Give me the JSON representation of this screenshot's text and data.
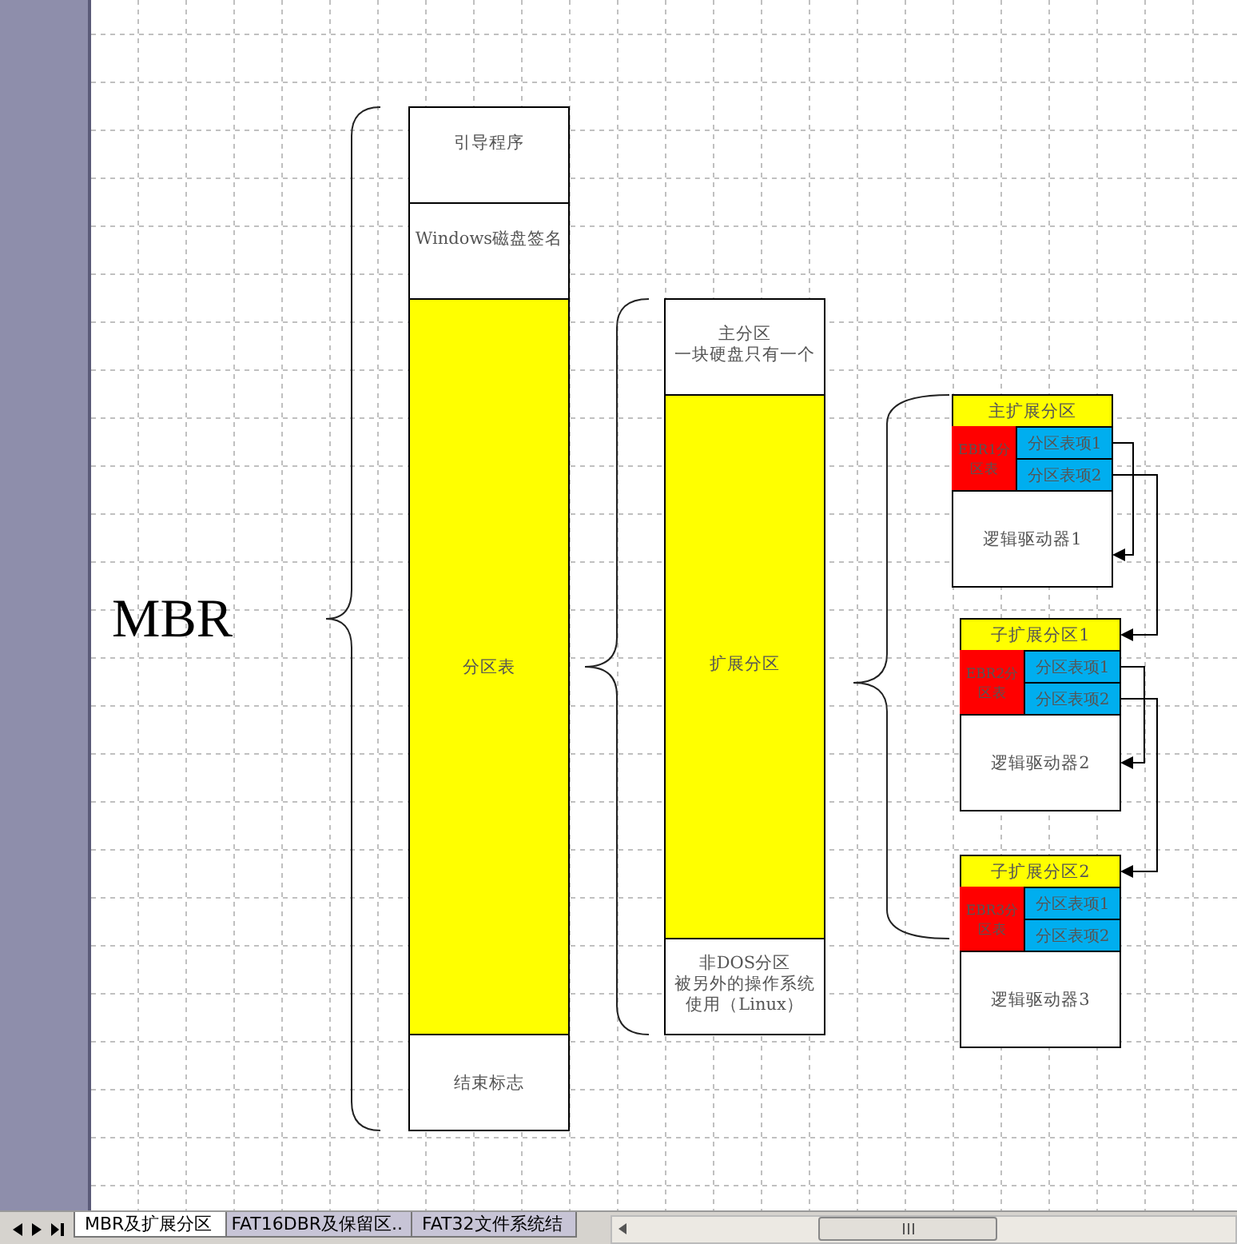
{
  "mbr_label": "MBR",
  "mbr_blocks": [
    {
      "lines": [
        "引导程序"
      ],
      "color": "#ffffff"
    },
    {
      "lines": [
        "Windows磁盘签名"
      ],
      "color": "#ffffff"
    },
    {
      "lines": [
        "分区表"
      ],
      "color": "#ffff00"
    },
    {
      "lines": [
        "结束标志"
      ],
      "color": "#ffffff"
    }
  ],
  "partition_blocks": [
    {
      "lines": [
        "主分区",
        "一块硬盘只有一个"
      ],
      "color": "#ffffff"
    },
    {
      "lines": [
        "扩展分区"
      ],
      "color": "#ffff00"
    },
    {
      "lines": [
        "非DOS分区",
        "被另外的操作系统",
        "使用（Linux）"
      ],
      "color": "#ffffff"
    }
  ],
  "extended_chain": [
    {
      "header": "主扩展分区",
      "ebr": [
        "EBR1分",
        "区表"
      ],
      "entries": [
        "分区表项1",
        "分区表项2"
      ],
      "drive": "逻辑驱动器1"
    },
    {
      "header": "子扩展分区1",
      "ebr": [
        "EBR2分",
        "区表"
      ],
      "entries": [
        "分区表项1",
        "分区表项2"
      ],
      "drive": "逻辑驱动器2"
    },
    {
      "header": "子扩展分区2",
      "ebr": [
        "EBR3分",
        "区表"
      ],
      "entries": [
        "分区表项1",
        "分区表项2"
      ],
      "drive": "逻辑驱动器3"
    }
  ],
  "sheet_tabs": [
    {
      "label": "MBR及扩展分区",
      "selected": true
    },
    {
      "label": "FAT16DBR及保留区..",
      "selected": false
    },
    {
      "label": "FAT32文件系统结",
      "selected": false
    }
  ]
}
